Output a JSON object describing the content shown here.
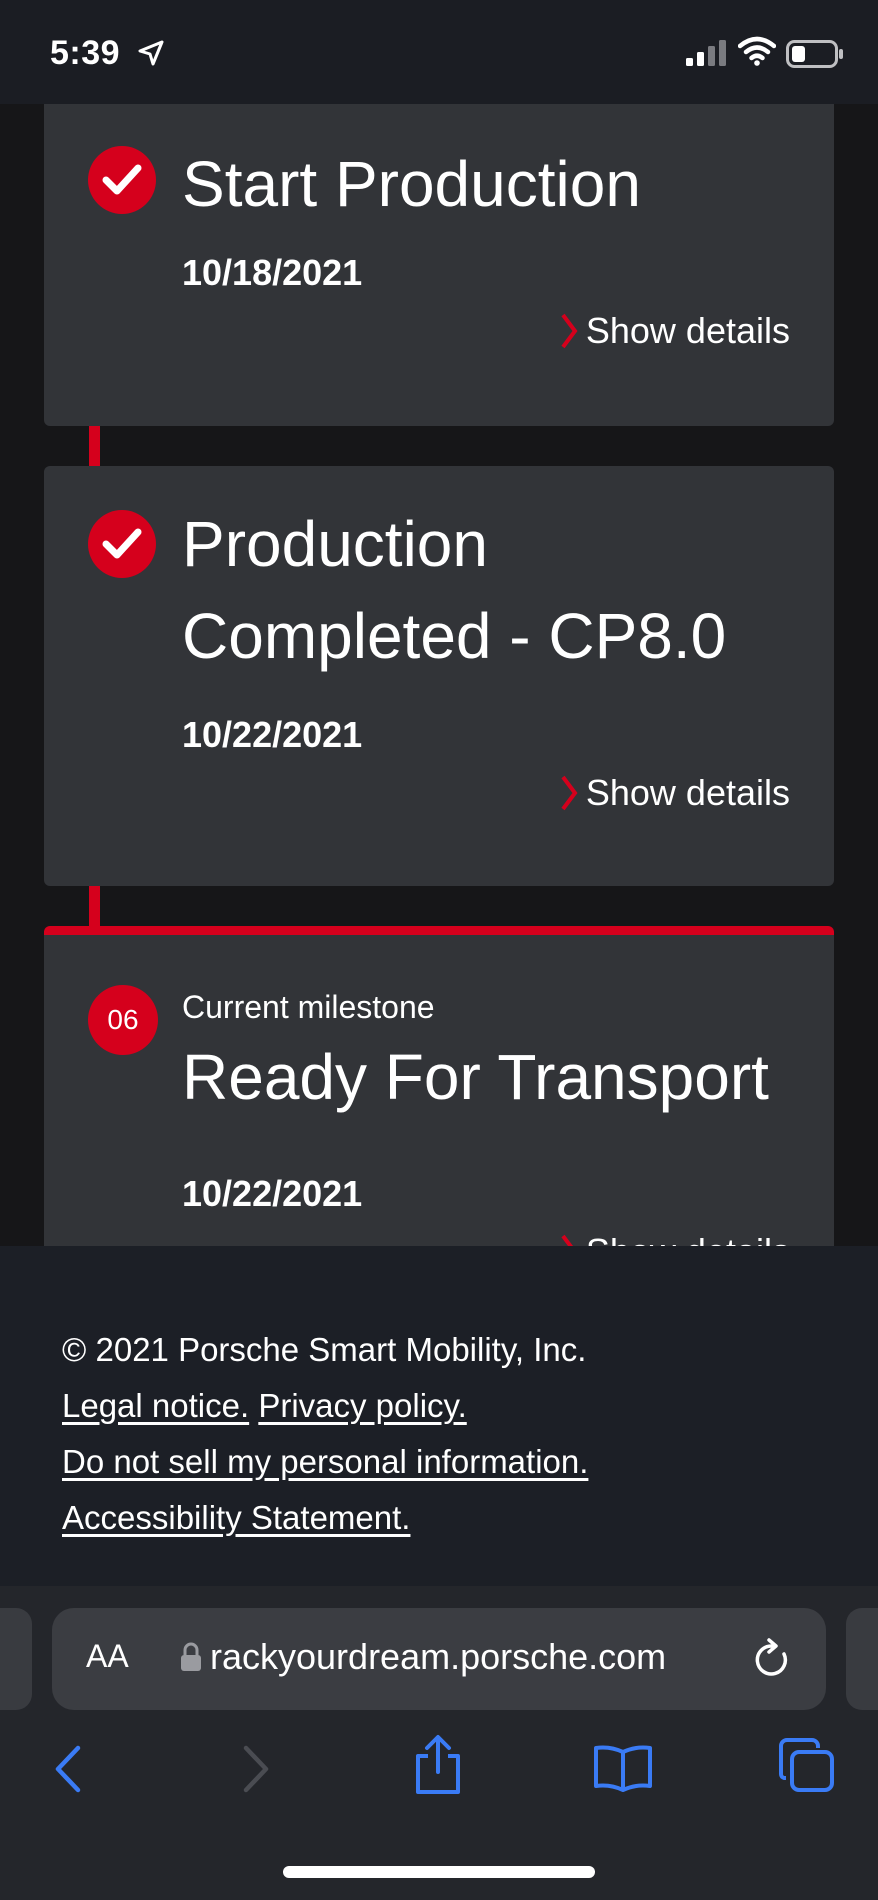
{
  "status_bar": {
    "time": "5:39"
  },
  "milestones": [
    {
      "title": "Start Production",
      "date": "10/18/2021",
      "details_label": "Show details",
      "completed": true
    },
    {
      "title": "Production Completed - CP8.0",
      "date": "10/22/2021",
      "details_label": "Show details",
      "completed": true
    },
    {
      "number": "06",
      "sublabel": "Current milestone",
      "title": "Ready For Transport",
      "date": "10/22/2021",
      "details_label": "Show details",
      "completed": false
    }
  ],
  "footer": {
    "copyright": "© 2021 Porsche Smart Mobility, Inc.",
    "legal_notice": "Legal notice.",
    "privacy_policy": "Privacy policy.",
    "do_not_sell": "Do not sell my personal information.",
    "accessibility": "Accessibility Statement."
  },
  "browser": {
    "aa_label": "AA",
    "url": "rackyourdream.porsche.com"
  },
  "colors": {
    "accent": "#d5001c",
    "card_bg": "#323438",
    "toolbar_icon": "#3a7bf5"
  }
}
